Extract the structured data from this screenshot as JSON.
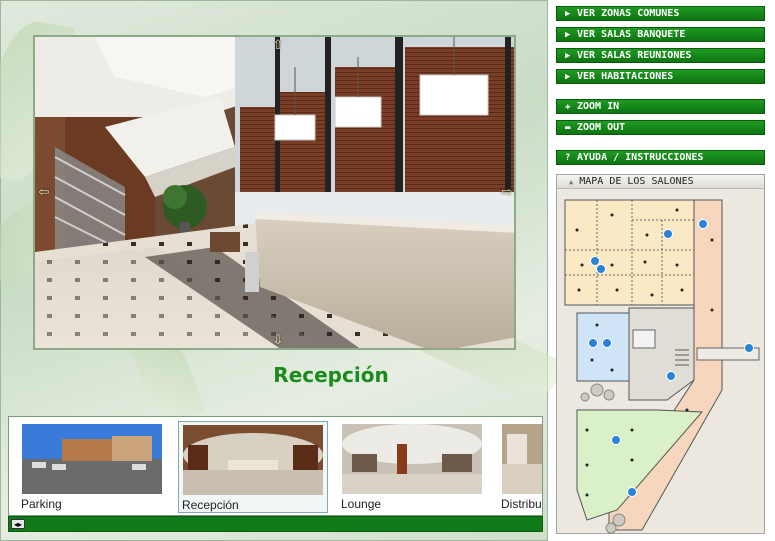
{
  "viewer": {
    "current_room": "Recepción"
  },
  "thumbnails": [
    {
      "label": "Parking",
      "active": false
    },
    {
      "label": "Recepción",
      "active": true
    },
    {
      "label": "Lounge",
      "active": false
    },
    {
      "label": "Distribu",
      "active": false
    }
  ],
  "buttons": {
    "zonas_comunes": {
      "icon": "play-icon",
      "label": "VER ZONAS COMUNES"
    },
    "salas_banquete": {
      "icon": "play-icon",
      "label": "VER SALAS BANQUETE"
    },
    "salas_reuniones": {
      "icon": "play-icon",
      "label": "VER SALAS REUNIONES"
    },
    "habitaciones": {
      "icon": "play-icon",
      "label": "VER HABITACIONES"
    },
    "zoom_in": {
      "icon": "plus-icon",
      "label": "ZOOM IN"
    },
    "zoom_out": {
      "icon": "minus-icon",
      "label": "ZOOM OUT"
    },
    "ayuda": {
      "icon": "question-icon",
      "label": "AYUDA / INSTRUCCIONES"
    }
  },
  "map": {
    "title": "MAPA DE LOS SALONES"
  },
  "colors": {
    "button_green": "#148a18",
    "title_green": "#1a8a1a",
    "map_yellow": "#fbe8c4",
    "map_blue": "#cfe4f6",
    "map_green": "#d9f0c8",
    "map_peach": "#f6d7bd",
    "hotspot_blue": "#2a83d8"
  }
}
